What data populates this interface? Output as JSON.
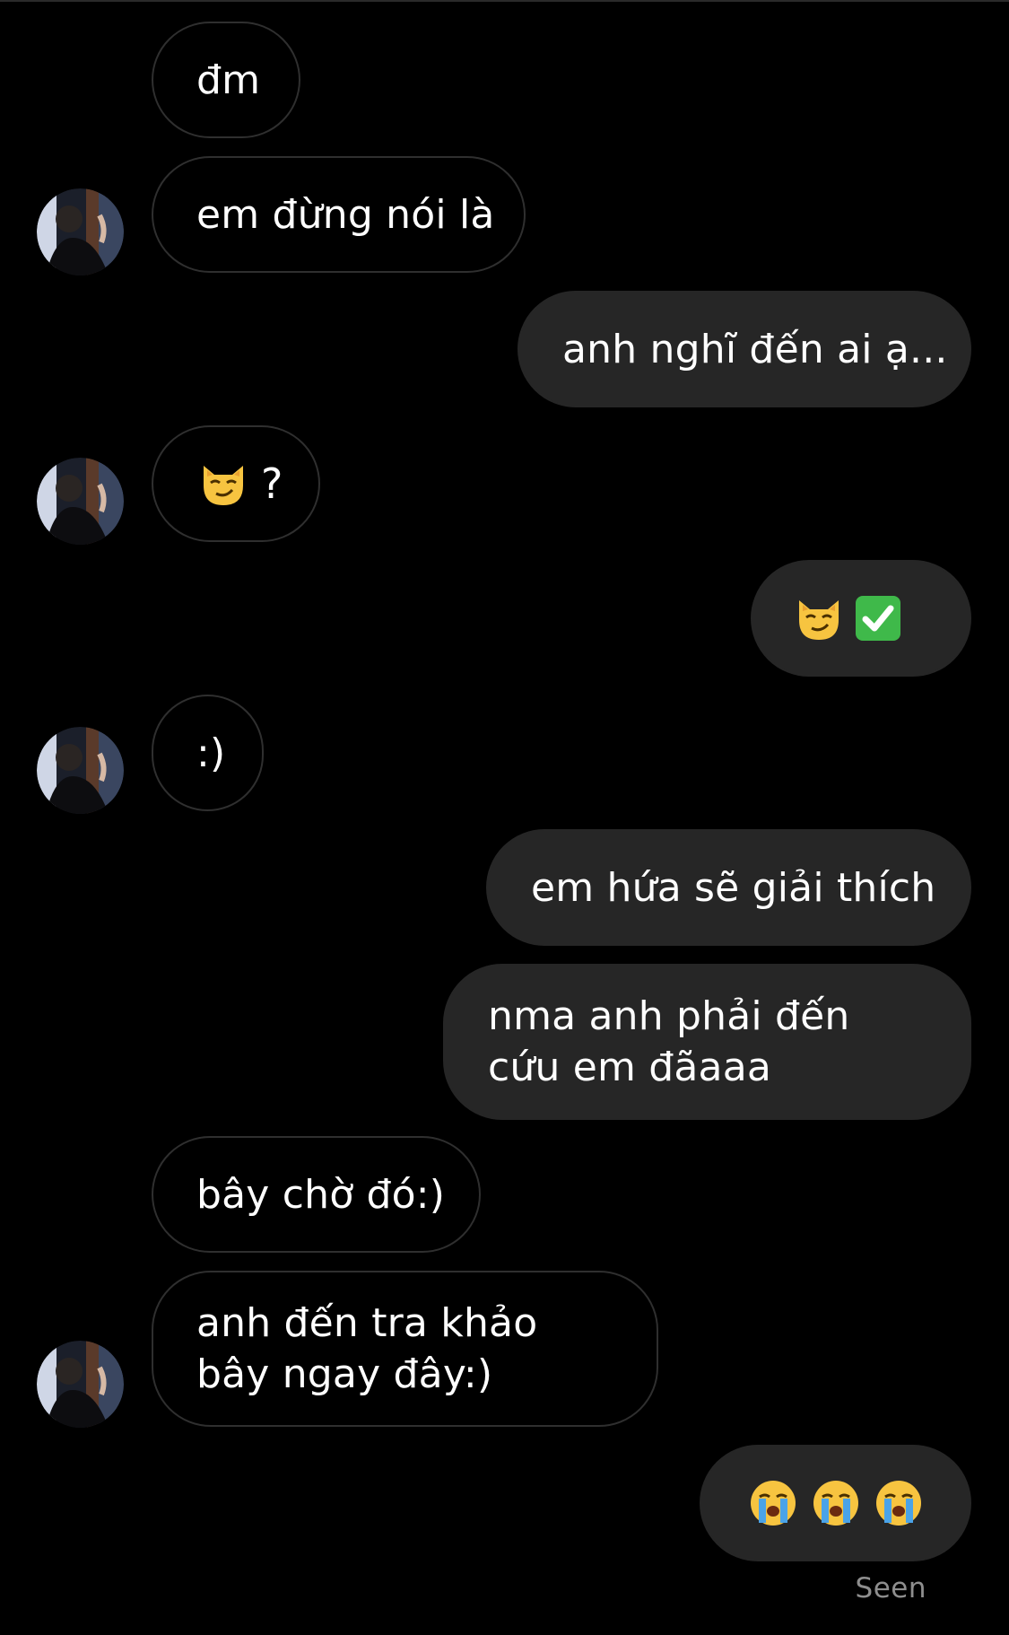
{
  "conversation": {
    "messages": [
      {
        "text": "đm"
      },
      {
        "text": "em đừng nói là"
      },
      {
        "text": "anh nghĩ đến ai ạ..."
      },
      {
        "text": "?",
        "emoji": "smirking-cat-emoji"
      },
      {
        "emoji": [
          "smirking-cat-emoji",
          "check-mark-emoji"
        ]
      },
      {
        "text": ":)"
      },
      {
        "text": "em hứa sẽ giải thích"
      },
      {
        "text": "nma anh phải đến cứu em đãaaa"
      },
      {
        "text": "bây chờ đó:)"
      },
      {
        "text": "anh đến tra khảo bây ngay đây:)"
      },
      {
        "emoji": [
          "loudly-crying-emoji",
          "loudly-crying-emoji",
          "loudly-crying-emoji"
        ]
      }
    ],
    "status": "Seen"
  },
  "colors": {
    "background": "#000000",
    "outgoing_bubble": "#262626",
    "incoming_border": "#2f2f2f",
    "text": "#ffffff",
    "seen_text": "#8e8e8e"
  }
}
